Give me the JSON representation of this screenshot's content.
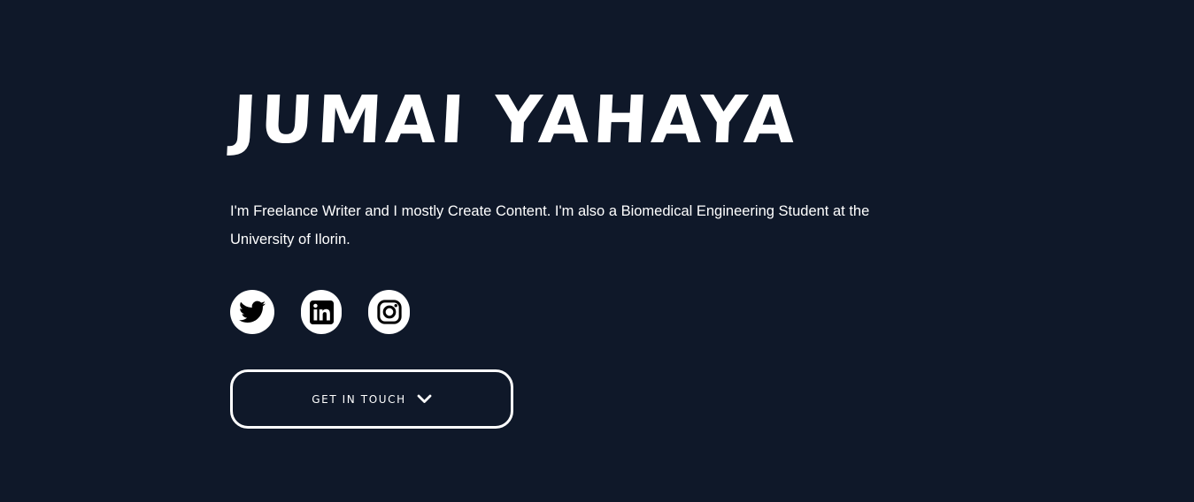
{
  "hero": {
    "name": "JUMAI YAHAYA",
    "bio": "I'm Freelance Writer and I mostly Create Content. I'm also a Biomedical Engineering Student at the University of Ilorin."
  },
  "socials": [
    {
      "icon": "twitter-icon"
    },
    {
      "icon": "linkedin-icon"
    },
    {
      "icon": "instagram-icon"
    }
  ],
  "cta": {
    "label": "GET IN TOUCH",
    "icon": "chevron-down-icon"
  },
  "colors": {
    "background": "#0f1829",
    "foreground": "#ffffff",
    "icon": "#000000"
  }
}
